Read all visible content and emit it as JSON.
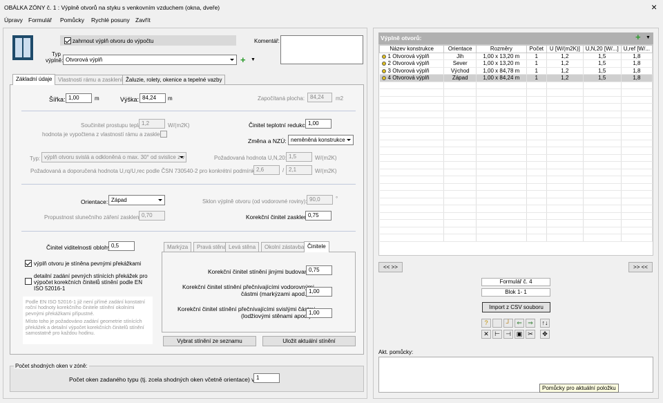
{
  "window": {
    "title": "OBÁLKA ZÓNY č. 1 : Výplně otvorů na styku s venkovním vzduchem (okna, dveře)",
    "close": "×"
  },
  "menu": [
    "Úpravy",
    "Formulář",
    "Pomůcky",
    "Rychlé posuny",
    "Zavřít"
  ],
  "top": {
    "include_label": "zahrnout výplň otvoru do výpočtu",
    "comment_label": "Komentář:",
    "type_label_1": "Typ",
    "type_label_2": "výplně:",
    "type_value": "Otvorová výplň"
  },
  "tabs": [
    "Základní údaje",
    "Vlastnosti rámu a zasklení",
    "Žaluzie, rolety, okenice a tepelné vazby"
  ],
  "dims": {
    "width_label": "Šířka:",
    "width_value": "1,00",
    "width_unit": "m",
    "height_label": "Výška:",
    "height_value": "84,24",
    "height_unit": "m",
    "area_label": "Započítaná plocha:",
    "area_value": "84,24",
    "area_unit": "m2"
  },
  "thermal": {
    "u_label": "Součinitel prostupu tepla:",
    "u_value": "1,2",
    "u_unit": "W/(m2K)",
    "computed_label": "hodnota je vypočtena z vlastností rámu a zasklení",
    "reduction_label": "Činitel teplotní redukce:",
    "reduction_value": "1,00",
    "nzu_label": "Změna a NZÚ:",
    "nzu_value": "neměněná konstrukce",
    "type_label": "Typ:",
    "type_value": "výplň otvoru svislá a odkloněná o max. 30° od svislice z v",
    "req_label": "Požadovaná hodnota U,N,20:",
    "req_value": "1,5",
    "req_unit": "W/(m2K)",
    "rec_label": "Požadovaná a doporučená hodnota U,rq/U,rec podle ČSN 730540-2 pro konkrétní podmínky:",
    "rq_value": "2,6",
    "rec_value": "2,1",
    "rec_unit": "W/(m2K)"
  },
  "orient": {
    "label": "Orientace:",
    "value": "Západ",
    "tilt_label": "Sklon výplně otvoru (od vodorovné roviny):",
    "tilt_value": "90,0",
    "tilt_unit": "°",
    "trans_label": "Propustnost slunečního záření zasklení:",
    "trans_value": "0,70",
    "corr_label": "Korekční činitel zasklení:",
    "corr_value": "0,75"
  },
  "shading": {
    "sky_label": "Činitel viditelnosti oblohy:",
    "sky_value": "0,5",
    "shaded_label": "výplň otvoru je stíněna pevnými překážkami",
    "detail_label": "detailní zadání pevných stínících překážek pro výpočet korekčních činitelů stínění podle EN ISO 52016-1",
    "note_1": "Podle EN ISO 52016-1 již není přímé zadání konstatní roční hodnoty korekčního činitele stínění okolními pevnými překážkami přípustné.",
    "note_2": "Místo toho je požadováno zadání geometrie stínících překážek a detailní výpočet korekčních činitelů stínění samostatně pro každou hodinu."
  },
  "subtabs": [
    "Markýza",
    "Pravá stěna",
    "Levá stěna",
    "Okolní zástavba",
    "Činitele"
  ],
  "factors": {
    "f1_label": "Korekční činitel stínění jinými budovami:",
    "f1_value": "0,75",
    "f2_label_1": "Korekční činitel stínění přečnívajícími vodorovnými",
    "f2_label_2": "částmi (markýzami apod.):",
    "f2_value": "1,00",
    "f3_label_1": "Korekční činitel stínění přečnívajícími svislými částmi",
    "f3_label_2": "(lodžiovými stěnami apod.):",
    "f3_value": "1,00"
  },
  "buttons": {
    "select_shading": "Vybrat stínění ze seznamu",
    "save_shading": "Uložit aktuální stínění",
    "prev": "<< >>",
    "next": ">> <<",
    "import_csv": "Import z CSV souboru"
  },
  "count": {
    "group_label": "Počet shodných oken v zóně:",
    "label": "Počet oken zadaného typu (tj. zcela shodných oken včetně orientace) v zóně:",
    "value": "1"
  },
  "list": {
    "title": "Výplně otvorů:",
    "columns": [
      "Název konstrukce",
      "Orientace",
      "Rozměry",
      "Počet",
      "U [W/(m2K)]",
      "U,N,20 [W/...]",
      "U,ref [W/..."
    ],
    "rows": [
      [
        "1",
        "Otvorová výplň",
        "Jih",
        "1,00 x 13,20 m",
        "1",
        "1,2",
        "1,5",
        "1,8"
      ],
      [
        "2",
        "Otvorová výplň",
        "Sever",
        "1,00 x 13,20 m",
        "1",
        "1,2",
        "1,5",
        "1,8"
      ],
      [
        "3",
        "Otvorová výplň",
        "Východ",
        "1,00 x 84,78 m",
        "1",
        "1,2",
        "1,5",
        "1,8"
      ],
      [
        "4",
        "Otvorová výplň",
        "Západ",
        "1,00 x 84,24 m",
        "1",
        "1,2",
        "1,5",
        "1,8"
      ]
    ]
  },
  "form": {
    "formular": "Formulář č. 4",
    "block": "Blok 1- 1"
  },
  "help": {
    "label": "Akt. pomůcky:",
    "tooltip": "Pomůcky pro aktuální položku"
  },
  "colors": {
    "list_header": "#b0b0b0",
    "selected_row": "#cfcfcf",
    "bullet": "#e0c020"
  }
}
